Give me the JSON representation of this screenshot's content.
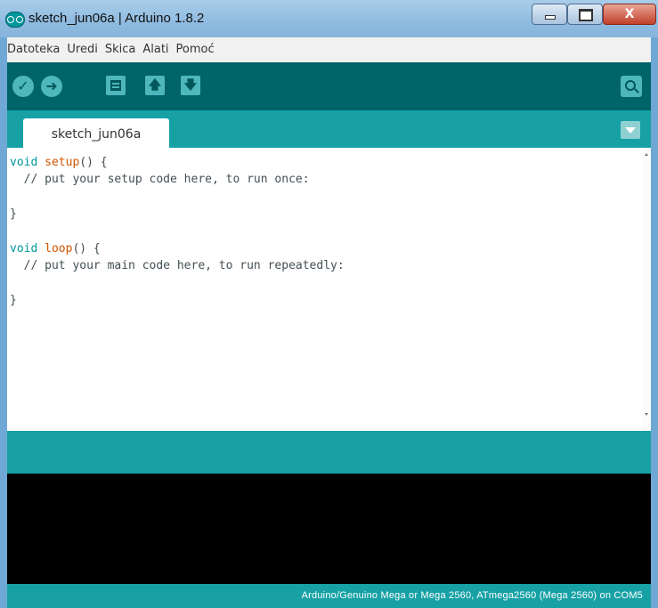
{
  "window": {
    "title": "sketch_jun06a | Arduino 1.8.2",
    "app_icon": "arduino-infinity-icon",
    "controls": {
      "close_glyph": "X"
    }
  },
  "menu": {
    "items": [
      "Datoteka",
      "Uredi",
      "Skica",
      "Alati",
      "Pomoć"
    ]
  },
  "toolbar": {
    "buttons": [
      {
        "name": "verify",
        "icon": "checkmark-icon",
        "glyph": "✓"
      },
      {
        "name": "upload",
        "icon": "right-arrow-icon",
        "glyph": "➜"
      },
      {
        "name": "new",
        "icon": "new-file-icon"
      },
      {
        "name": "open",
        "icon": "up-arrow-icon",
        "glyph": "🡅"
      },
      {
        "name": "save",
        "icon": "down-arrow-icon",
        "glyph": "🡇"
      },
      {
        "name": "serial-monitor",
        "icon": "magnifier-icon"
      }
    ],
    "colors": {
      "bar": "#006468",
      "button": "#4db7bb"
    }
  },
  "tabs": [
    {
      "label": "sketch_jun06a"
    }
  ],
  "editor": {
    "lines": [
      {
        "kw": "void ",
        "fn": "setup",
        "rest": "() {"
      },
      {
        "comment": "  // put your setup code here, to run once:"
      },
      {
        "text": ""
      },
      {
        "text": "}"
      },
      {
        "text": ""
      },
      {
        "kw": "void ",
        "fn": "loop",
        "rest": "() {"
      },
      {
        "comment": "  // put your main code here, to run repeatedly:"
      },
      {
        "text": ""
      },
      {
        "text": "}"
      }
    ],
    "colors": {
      "keyword": "#00979c",
      "function": "#d35400",
      "text": "#434f54"
    }
  },
  "status": {
    "board": "Arduino/Genuino Mega or Mega 2560, ATmega2560 (Mega 2560) on COM5"
  },
  "colors": {
    "teal": "#17a1a5",
    "console": "#000000"
  }
}
